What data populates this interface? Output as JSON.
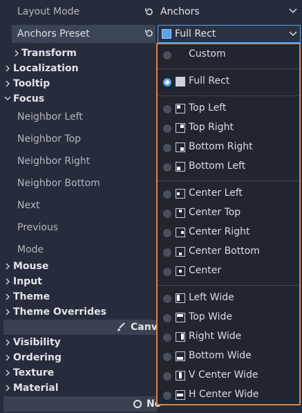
{
  "layout_mode": {
    "label": "Layout Mode",
    "value": "Anchors"
  },
  "anchors_preset": {
    "label": "Anchors Preset",
    "value": "Full Rect"
  },
  "sections_top": [
    {
      "label": "Transform",
      "expanded": false
    },
    {
      "label": "Localization",
      "expanded": false
    },
    {
      "label": "Tooltip",
      "expanded": false
    },
    {
      "label": "Focus",
      "expanded": true
    }
  ],
  "focus_props": [
    "Neighbor Left",
    "Neighbor Top",
    "Neighbor Right",
    "Neighbor Bottom",
    "Next",
    "Previous",
    "Mode"
  ],
  "sections_mid": [
    "Mouse",
    "Input",
    "Theme",
    "Theme Overrides"
  ],
  "canvas_bar": "Canva",
  "sections_bottom": [
    "Visibility",
    "Ordering",
    "Texture",
    "Material"
  ],
  "node_bar": "No",
  "dropdown": {
    "custom": "Custom",
    "full_rect": "Full Rect",
    "corners": [
      "Top Left",
      "Top Right",
      "Bottom Right",
      "Bottom Left"
    ],
    "centers": [
      "Center Left",
      "Center Top",
      "Center Right",
      "Center Bottom",
      "Center"
    ],
    "wides": [
      "Left Wide",
      "Top Wide",
      "Right Wide",
      "Bottom Wide",
      "V Center Wide",
      "H Center Wide"
    ]
  },
  "colors": {
    "accent": "#e0833b",
    "selected_radio": "#5aa2ee",
    "preset_icon": "#5aa2ee"
  }
}
